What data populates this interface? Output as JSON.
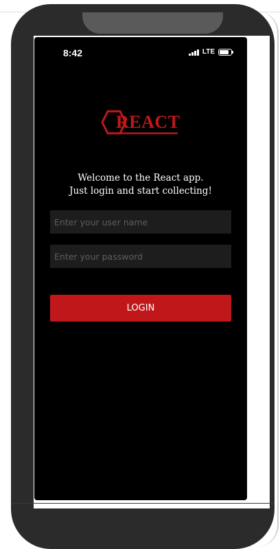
{
  "status_bar": {
    "time": "8:42",
    "network": "LTE",
    "signal_icon": "signal-bars-icon",
    "battery_icon": "battery-icon"
  },
  "logo": {
    "text": "REACT"
  },
  "welcome": {
    "line1": "Welcome to the React app.",
    "line2": "Just login and start collecting!"
  },
  "form": {
    "username_placeholder": "Enter your user name",
    "username_value": "",
    "password_placeholder": "Enter your password",
    "password_value": ""
  },
  "login_button": {
    "label": "LOGIN"
  },
  "colors": {
    "accent": "#c0171b",
    "screen_bg": "#000000",
    "field_bg": "#1d1d1d",
    "device": "#2b2b2b"
  }
}
